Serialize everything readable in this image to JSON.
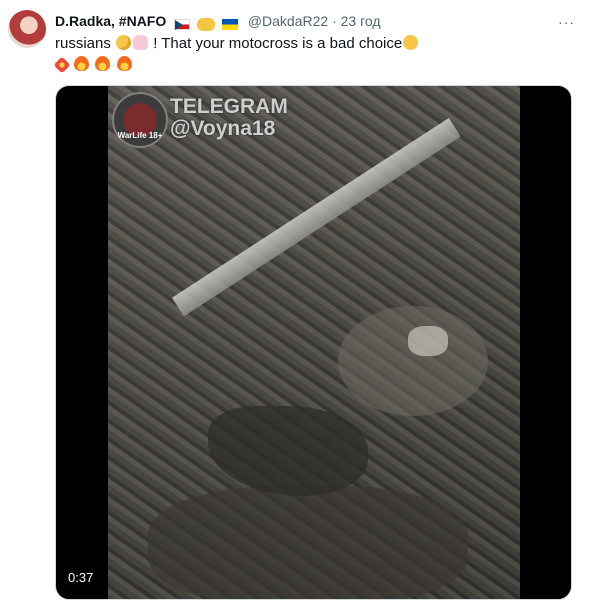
{
  "tweet": {
    "author_name": "D.Radka, #NAFO",
    "handle": "@DakdaR22",
    "separator": "·",
    "time": "23 год",
    "text_word1": "russians",
    "text_main": "! That your motocross is a bad choice",
    "more_label": "···"
  },
  "media": {
    "watermark_logo": "WarLife 18+",
    "watermark_line1": "TELEGRAM",
    "watermark_line2": "@Voyna18",
    "duration": "0:37"
  },
  "icons": [
    "czech-flag-icon",
    "handshake-icon",
    "ukraine-flag-icon",
    "monocle-face-icon",
    "person-shrugging-icon",
    "shushing-face-icon",
    "collision-icon",
    "fire-icon"
  ]
}
